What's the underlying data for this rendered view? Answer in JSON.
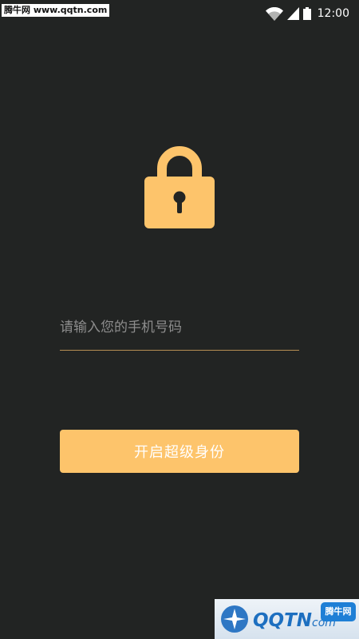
{
  "status_bar": {
    "watermark": "腾牛网 www.qqtn.com",
    "time": "12:00",
    "icons": [
      "wifi-icon",
      "cellular-signal-icon",
      "battery-icon"
    ]
  },
  "lock": {
    "icon": "padlock-icon"
  },
  "phone": {
    "placeholder": "请输入您的手机号码",
    "value": ""
  },
  "activate_button": {
    "label": "开启超级身份"
  },
  "watermark_bottom": {
    "brand": "QQTN",
    "suffix": "com",
    "badge": "腾牛网"
  },
  "colors": {
    "background": "#222423",
    "accent": "#fdc46b",
    "underline": "#b58e52",
    "placeholder": "#8d8d8d"
  }
}
